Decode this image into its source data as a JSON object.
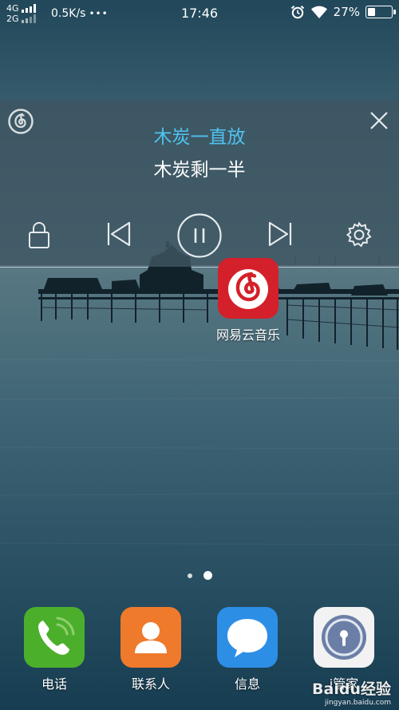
{
  "status_bar": {
    "network_top": "4G",
    "network_bottom": "2G",
    "net_speed": "0.5K/s",
    "more_dots": "•••",
    "time": "17:46",
    "battery_percent": "27%",
    "battery_level": 0.27
  },
  "music_panel": {
    "song_title": "木炭一直放",
    "lyric_line": "木炭剩一半",
    "title_color": "#4ec3f0",
    "controls": [
      "lock-icon",
      "previous-icon",
      "pause-icon",
      "next-icon",
      "settings-icon"
    ]
  },
  "home_apps": [
    {
      "label": "网易云音乐",
      "icon": "netease-music-icon",
      "color": "#d4202a"
    }
  ],
  "page_indicator": {
    "pages": 2,
    "active": 1
  },
  "dock": [
    {
      "label": "电话",
      "icon": "phone-icon",
      "color": "#4caf2c"
    },
    {
      "label": "联系人",
      "icon": "contact-icon",
      "color": "#ef7a2c"
    },
    {
      "label": "信息",
      "icon": "message-icon",
      "color": "#2d8ee6"
    },
    {
      "label": "i管家",
      "icon": "security-lock-icon",
      "color": "#f2f2f2"
    }
  ],
  "watermark": {
    "main": "Baidu经验",
    "sub": "jingyan.baidu.com"
  }
}
